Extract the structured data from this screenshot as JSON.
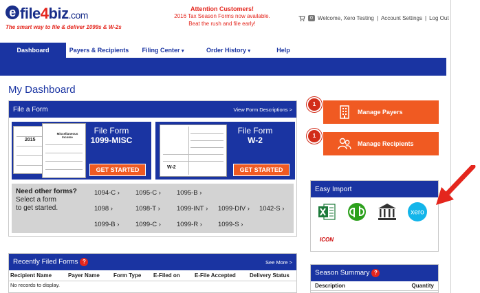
{
  "header": {
    "logo_text": "file4biz",
    "logo_domain": ".com",
    "logo_tagline": "The smart way to file & deliver 1099s & W-2s",
    "attention_title": "Attention Customers!",
    "attention_line1": "2016 Tax Season Forms now available.",
    "attention_line2": "Beat the rush and file early!",
    "cart_count": "0",
    "welcome": "Welcome, Xero Testing",
    "account_settings": "Account Settings",
    "logout": "Log Out"
  },
  "nav": {
    "dashboard": "Dashboard",
    "payers": "Payers & Recipients",
    "filing": "Filing Center",
    "history": "Order History",
    "help": "Help"
  },
  "page_title": "My Dashboard",
  "file_form": {
    "title": "File a Form",
    "view_link": "View Form Descriptions >",
    "misc_line1": "File Form",
    "misc_line2": "1099-MISC",
    "w2_line1": "File Form",
    "w2_line2": "W-2",
    "get_started": "GET STARTED",
    "need_other": "Need other forms?",
    "select_form": "Select a form",
    "to_get_started": "to get started.",
    "forms_row1": [
      "1094-C ›",
      "1095-C ›",
      "1095-B ›"
    ],
    "forms_row2": [
      "1098 ›",
      "1098-T ›",
      "1099-INT ›",
      "1099-DIV ›",
      "1042-S ›"
    ],
    "forms_row3": [
      "1099-B ›",
      "1099-C ›",
      "1099-R ›",
      "1099-S ›"
    ],
    "paper_year": "2015",
    "paper_misc": "Miscellaneous Income",
    "paper_w2": "W-2"
  },
  "actions": {
    "manage_payers": "Manage Payers",
    "manage_payers_count": "1",
    "manage_recipients": "Manage Recipients",
    "manage_recipients_count": "1"
  },
  "easy_import": {
    "title": "Easy Import",
    "xero_label": "xero",
    "icon_label": "ICON"
  },
  "recent": {
    "title": "Recently Filed Forms",
    "help": "?",
    "see_more": "See More >",
    "columns": [
      "Recipient Name",
      "Payer Name",
      "Form Type",
      "E-Filed on",
      "E-File Accepted",
      "Delivery Status"
    ],
    "empty": "No records to display."
  },
  "season": {
    "title": "Season Summary",
    "help": "?",
    "col_description": "Description",
    "col_quantity": "Quantity"
  },
  "colors": {
    "brand_blue": "#1a34a2",
    "brand_orange": "#f05a22",
    "alert_red": "#e4261d"
  }
}
